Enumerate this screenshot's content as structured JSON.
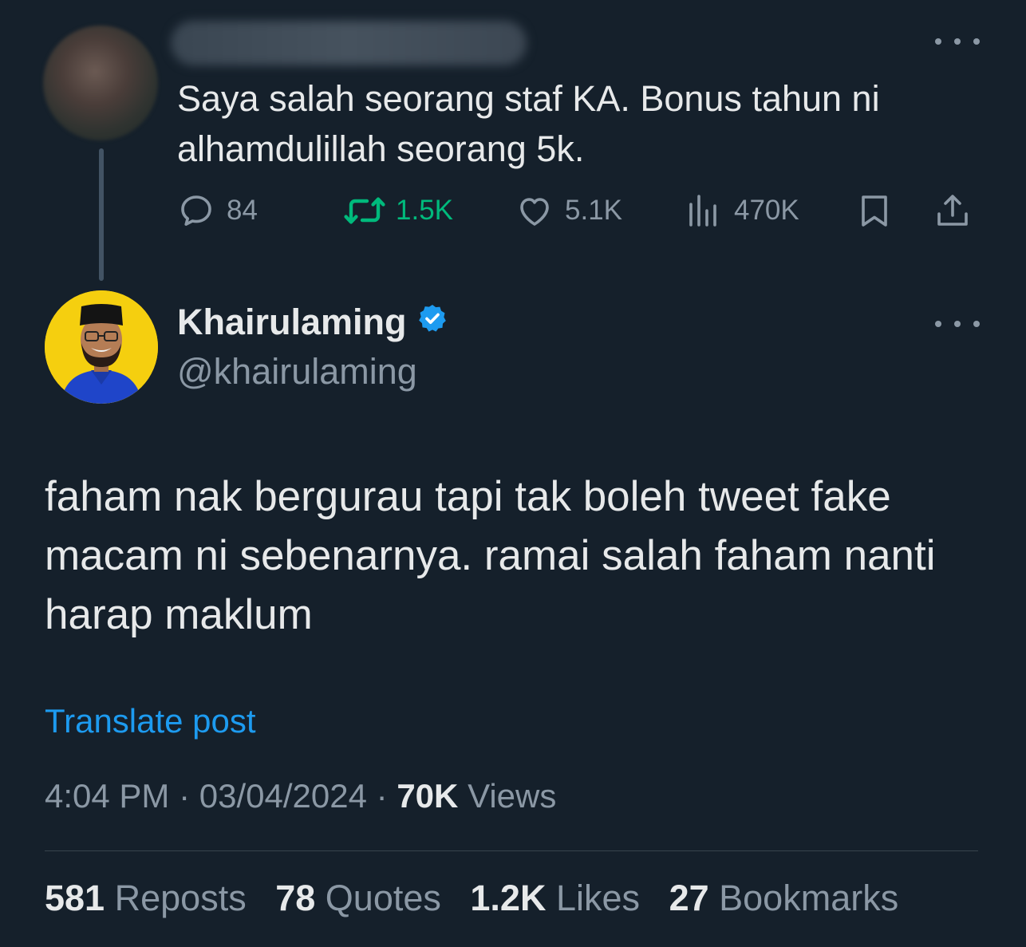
{
  "parent_tweet": {
    "text": "Saya salah seorang staf KA. Bonus tahun ni alhamdulillah seorang 5k.",
    "actions": {
      "replies": "84",
      "reposts": "1.5K",
      "likes": "5.1K",
      "views": "470K"
    },
    "icons": [
      "reply-icon",
      "repost-icon",
      "like-icon",
      "views-icon",
      "bookmark-icon",
      "share-icon"
    ]
  },
  "main_tweet": {
    "author_name": "Khairulaming",
    "author_handle": "@khairulaming",
    "text": "faham nak bergurau tapi tak boleh tweet fake macam ni sebenarnya. ramai salah faham nanti harap maklum",
    "translate_label": "Translate post",
    "time": "4:04 PM",
    "separator": "·",
    "date": "03/04/2024",
    "views_count": "70K",
    "views_label": "Views",
    "stats": [
      {
        "count": "581",
        "label": "Reposts"
      },
      {
        "count": "78",
        "label": "Quotes"
      },
      {
        "count": "1.2K",
        "label": "Likes"
      },
      {
        "count": "27",
        "label": "Bookmarks"
      }
    ]
  },
  "colors": {
    "background": "#15202b",
    "text": "#e7e9ea",
    "muted": "#8b98a5",
    "accent": "#1d9bf0",
    "repost_active": "#00ba7c",
    "avatar_bg": "#f5cf0f"
  }
}
